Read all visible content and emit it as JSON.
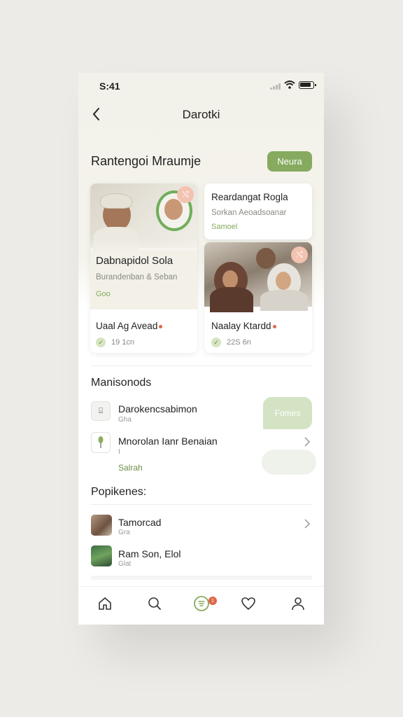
{
  "status": {
    "time": "S:41"
  },
  "header": {
    "title": "Darotki"
  },
  "featured": {
    "title": "Rantengoi Mraumje",
    "new_button": "Neura",
    "cards": [
      {
        "title": "Dabnapidol Sola",
        "subtitle": "Burandenban & Seban",
        "tag": "Goo",
        "foot_title": "Uaal Ag Avead",
        "meta": "19 1cn"
      },
      {
        "title": "Reardangat Rogla",
        "subtitle": "Sorkan Aeoadsoanar",
        "tag": "Samoel",
        "foot_title": "Naalay Ktardd",
        "meta": "22S 6n"
      }
    ]
  },
  "maniso": {
    "title": "Manisonods",
    "items": [
      {
        "title": "Darokencsabimon",
        "subtitle": "Gha"
      },
      {
        "title": "Mnorolan Ianr Benaian",
        "subtitle": "I"
      }
    ],
    "link": "Salrah",
    "bubble": "Fomes"
  },
  "popular": {
    "title": "Popikenes:",
    "items": [
      {
        "title": "Tamorcad",
        "subtitle": "Gra"
      },
      {
        "title": "Ram Son, Elol",
        "subtitle": "Glat"
      }
    ]
  },
  "tabbar": {
    "badge": "1"
  },
  "colors": {
    "accent": "#86aa5f",
    "alert": "#e0674a",
    "tint": "#f4f2ea"
  }
}
